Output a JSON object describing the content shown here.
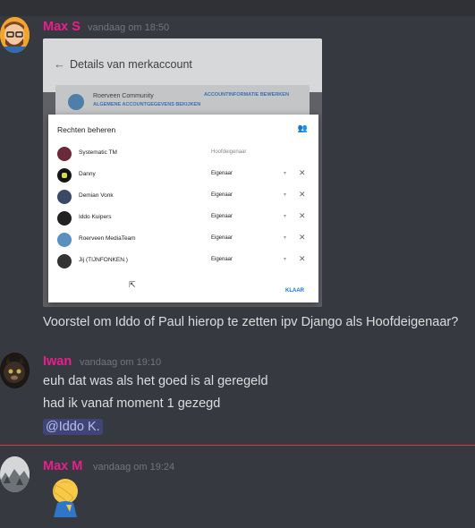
{
  "messages": [
    {
      "username": "Max S",
      "timestamp": "vandaag om 18:50",
      "lines": [
        "Voorstel om Iddo of Paul hierop te zetten ipv Django als Hoofdeigenaar?"
      ]
    },
    {
      "username": "Iwan",
      "timestamp": "vandaag om 19:10",
      "lines": [
        "euh dat was als het goed is al geregeld",
        "had ik vanaf moment 1 gezegd"
      ],
      "mention": "@Iddo K."
    },
    {
      "username": "Max M",
      "timestamp": "vandaag om 19:24",
      "emoji": "face-palm-emoji"
    }
  ],
  "attachment": {
    "header_title": "Details van merkaccount",
    "account_name": "Roerveen Community",
    "account_link": "ALGEMENE ACCOUNTGEGEVENS BEKIJKEN",
    "edit_link": "ACCOUNTINFORMATIE BEWERKEN",
    "dialog_title": "Rechten beheren",
    "done_label": "KLAAR",
    "rows": [
      {
        "name": "Systematic TM",
        "role": "Hoofdeigenaar"
      },
      {
        "name": "Danny",
        "role": "Eigenaar"
      },
      {
        "name": "Demian Vonk",
        "role": "Eigenaar"
      },
      {
        "name": "Iddo Kuipers",
        "role": "Eigenaar"
      },
      {
        "name": "Roerveen MediaTeam",
        "role": "Eigenaar"
      },
      {
        "name": "Jij (TIJNFONKEN.)",
        "role": "Eigenaar"
      }
    ]
  },
  "colors": {
    "background": "#36393f",
    "username": "#e91e8c",
    "timestamp": "#72767d",
    "divider": "#c6404e",
    "mention_text": "#b9bcf2"
  }
}
